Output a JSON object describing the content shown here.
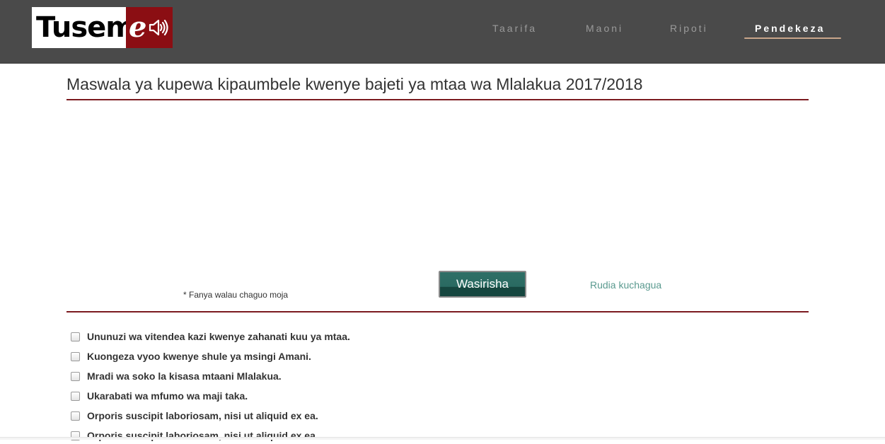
{
  "brand": {
    "logo_text": "Tusem",
    "logo_accent": "e",
    "colors": {
      "header_bg": "#4a4a4a",
      "logo_red": "#8b0e13",
      "rule": "#7b1a1f",
      "button": "#2a6a62",
      "link": "#5a9a8f"
    }
  },
  "nav": {
    "items": [
      {
        "label": "Taarifa"
      },
      {
        "label": "Maoni"
      },
      {
        "label": "Ripoti"
      },
      {
        "label": "Pendekeza"
      }
    ]
  },
  "main": {
    "title": "Maswala ya kupewa kipaumbele kwenye bajeti ya mtaa wa Mlalakua 2017/2018",
    "hint": "* Fanya walau chaguo moja",
    "submit_label": "Wasirisha",
    "reset_label": "Rudia kuchagua",
    "options": [
      {
        "label": "Ununuzi wa vitendea kazi kwenye zahanati kuu ya mtaa.",
        "checked": false
      },
      {
        "label": "Kuongeza vyoo kwenye shule ya msingi Amani.",
        "checked": false
      },
      {
        "label": "Mradi wa soko la kisasa mtaani Mlalakua.",
        "checked": false
      },
      {
        "label": "Ukarabati wa mfumo wa maji taka.",
        "checked": false
      },
      {
        "label": "Orporis suscipit laboriosam, nisi ut aliquid ex ea.",
        "checked": false
      },
      {
        "label": "Orporis suscipit laboriosam, nisi ut aliquid ex ea.",
        "checked": false
      }
    ]
  }
}
